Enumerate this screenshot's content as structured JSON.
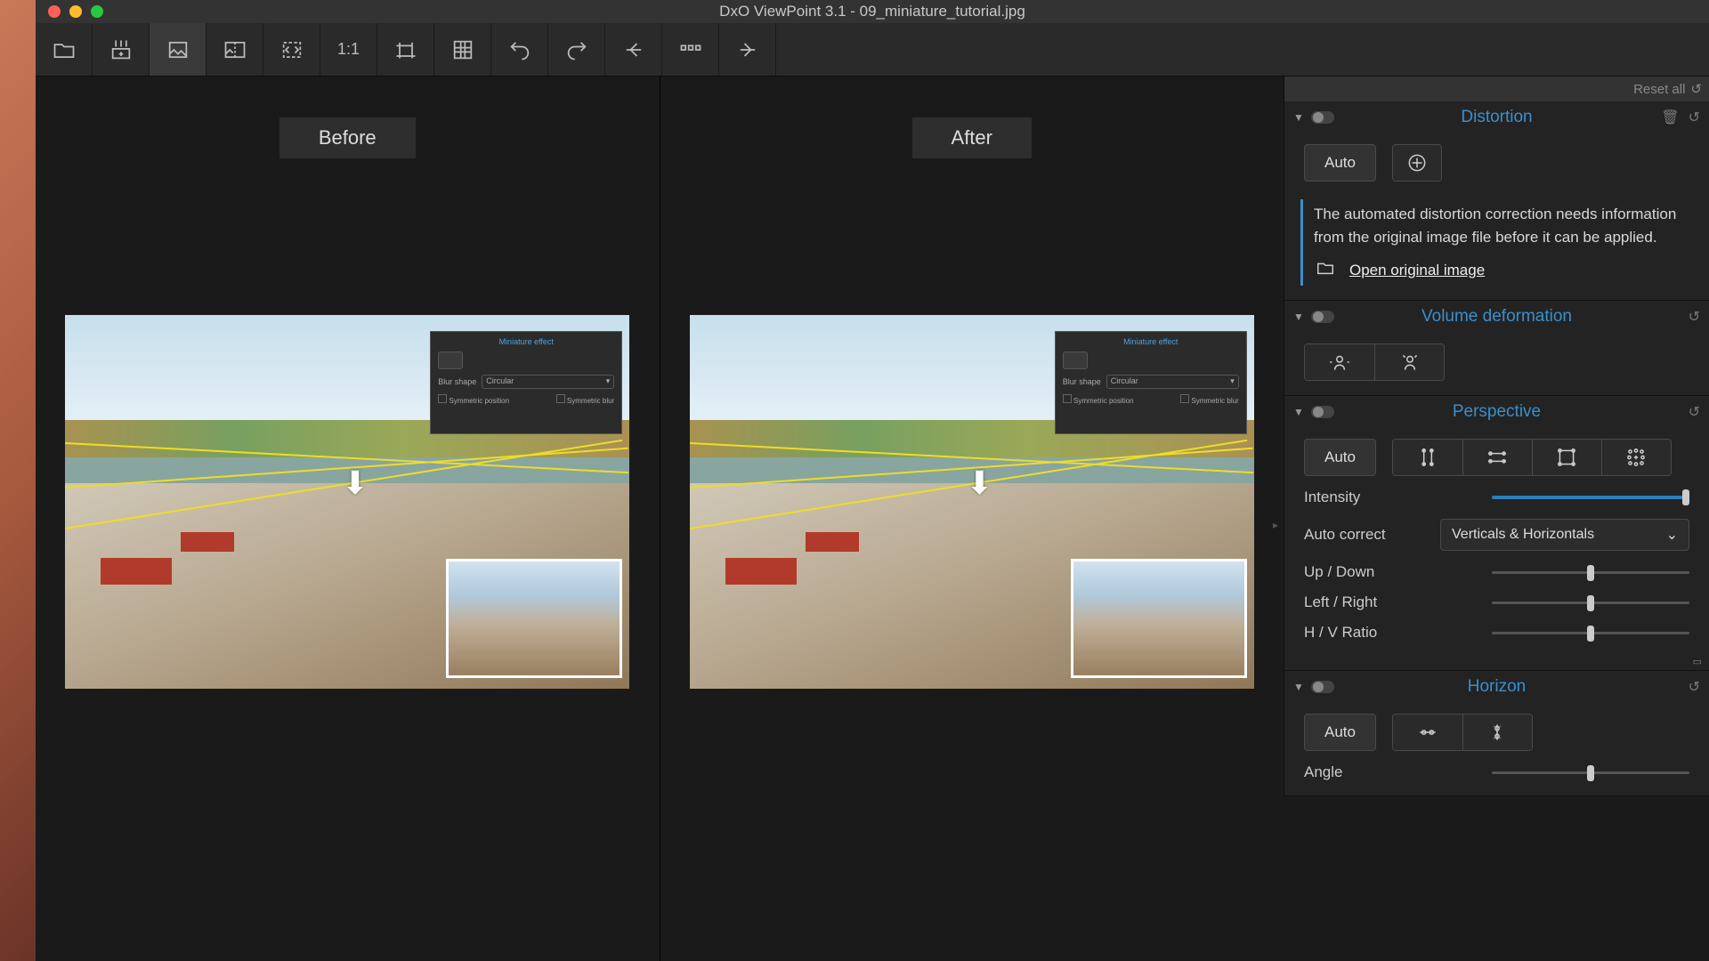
{
  "titlebar": {
    "title": "DxO ViewPoint 3.1 - 09_miniature_tutorial.jpg"
  },
  "toolbar": {
    "one_to_one": "1:1"
  },
  "viewer": {
    "before_label": "Before",
    "after_label": "After"
  },
  "mini_panel": {
    "title": "Miniature effect",
    "blur_shape": "Blur shape",
    "blur_shape_val": "Circular",
    "sym_pos": "Symmetric position",
    "sym_blur": "Symmetric blur"
  },
  "reset": {
    "label": "Reset all"
  },
  "distortion": {
    "title": "Distortion",
    "auto": "Auto",
    "info": "The automated distortion correction needs information from the original image file before it can be applied.",
    "open_link": "Open original image"
  },
  "volume": {
    "title": "Volume deformation"
  },
  "perspective": {
    "title": "Perspective",
    "auto": "Auto",
    "intensity": "Intensity",
    "auto_correct": "Auto correct",
    "auto_correct_val": "Verticals & Horizontals",
    "updown": "Up / Down",
    "leftright": "Left / Right",
    "hvratio": "H / V Ratio"
  },
  "horizon": {
    "title": "Horizon",
    "auto": "Auto",
    "angle": "Angle"
  }
}
